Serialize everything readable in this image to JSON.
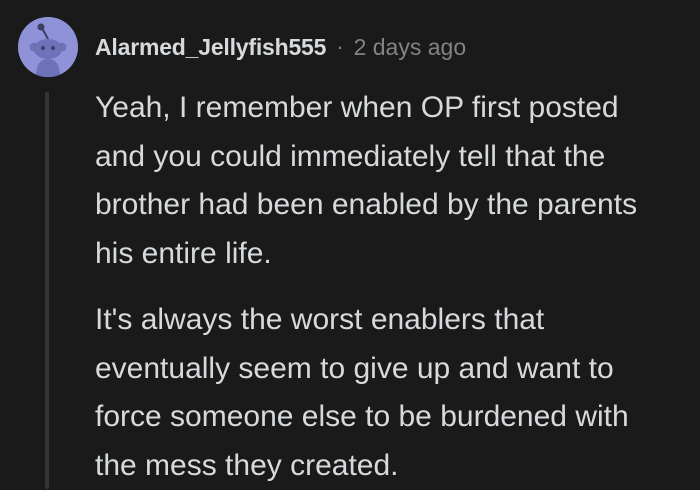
{
  "comment": {
    "avatar_icon": "reddit-snoo-avatar-icon",
    "username": "Alarmed_Jellyfish555",
    "separator": "·",
    "timestamp": "2 days ago",
    "paragraphs": [
      {
        "lines": [
          "Yeah, I remember when OP first posted",
          "and you could immediately tell that the",
          "brother had been enabled by the parents",
          "his entire life."
        ]
      },
      {
        "lines": [
          "It's always the worst enablers that",
          "eventually seem to give up and want to",
          "force someone else to be burdened with",
          "the mess they created."
        ]
      }
    ]
  },
  "colors": {
    "background": "#1a1a1b",
    "text": "#d7dadc",
    "muted": "#818384",
    "avatar_bg": "#8f92d6",
    "thread_line": "#343536"
  }
}
